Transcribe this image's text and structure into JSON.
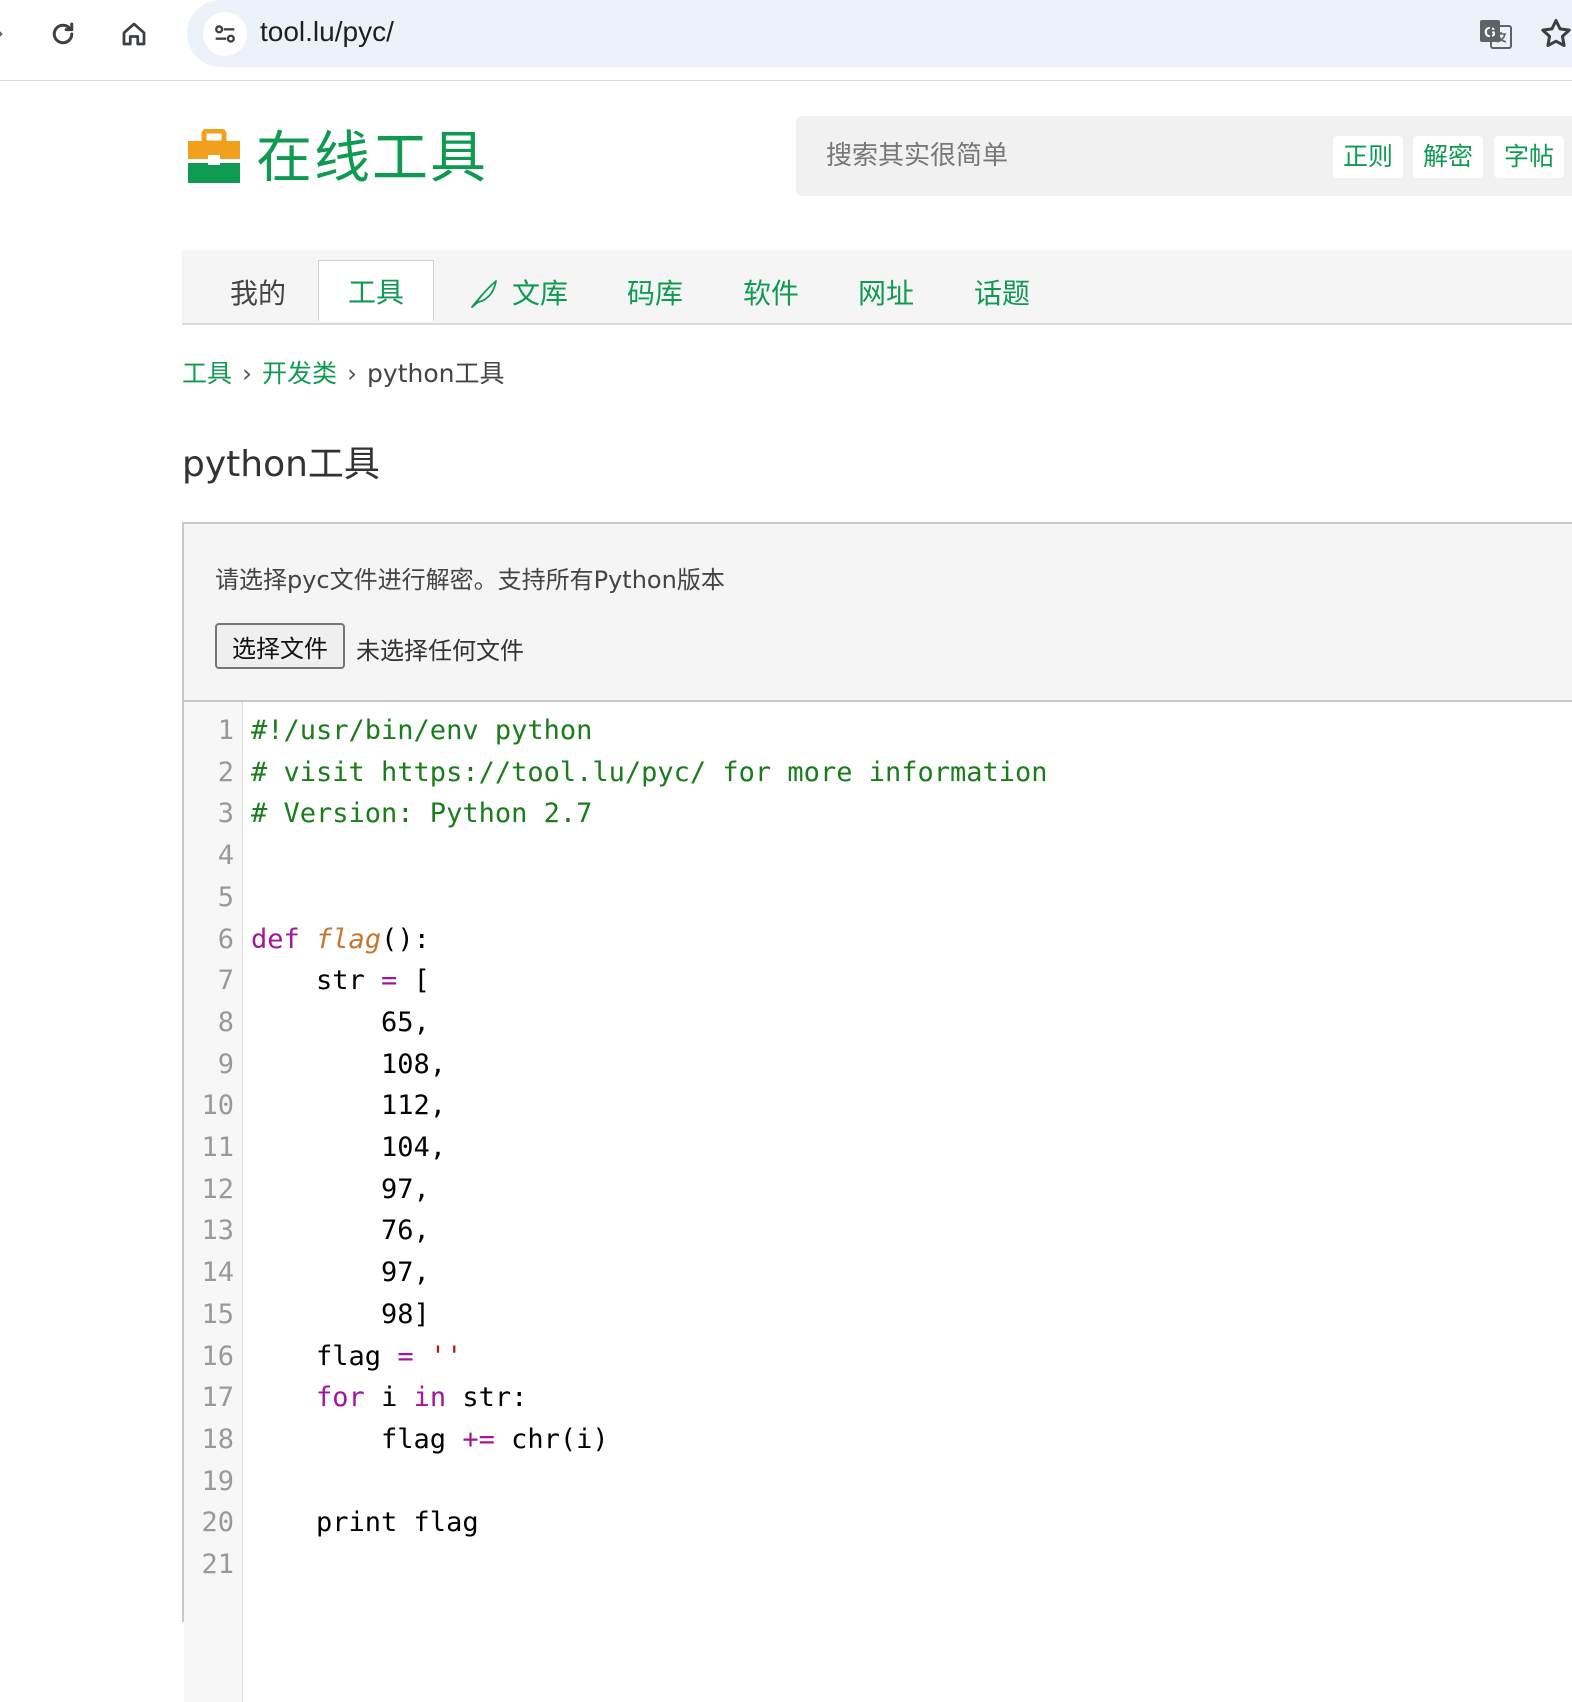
{
  "browser": {
    "url": "tool.lu/pyc/"
  },
  "header": {
    "site_title": "在线工具",
    "search_placeholder": "搜索其实很简单",
    "quick_links": [
      "正则",
      "解密",
      "字帖"
    ]
  },
  "tabs": {
    "mine": "我的",
    "tools": "工具",
    "library": "文库",
    "code": "码库",
    "software": "软件",
    "sites": "网址",
    "topics": "话题"
  },
  "breadcrumb": {
    "root": "工具",
    "category": "开发类",
    "current": "python工具"
  },
  "page": {
    "title": "python工具"
  },
  "tool": {
    "instruction": "请选择pyc文件进行解密。支持所有Python版本",
    "file_button": "选择文件",
    "file_status": "未选择任何文件"
  },
  "code": {
    "lines": [
      {
        "n": "1",
        "parts": [
          {
            "t": "#!/usr/bin/env python",
            "c": "comment"
          }
        ]
      },
      {
        "n": "2",
        "parts": [
          {
            "t": "# visit https://tool.lu/pyc/ for more information",
            "c": "comment"
          }
        ]
      },
      {
        "n": "3",
        "parts": [
          {
            "t": "# Version: Python 2.7",
            "c": "comment"
          }
        ]
      },
      {
        "n": "4",
        "parts": []
      },
      {
        "n": "5",
        "parts": []
      },
      {
        "n": "6",
        "parts": [
          {
            "t": "def",
            "c": "kw"
          },
          {
            "t": " ",
            "c": ""
          },
          {
            "t": "flag",
            "c": "fn"
          },
          {
            "t": "():",
            "c": ""
          }
        ]
      },
      {
        "n": "7",
        "parts": [
          {
            "t": "    str ",
            "c": ""
          },
          {
            "t": "=",
            "c": "op"
          },
          {
            "t": " [",
            "c": ""
          }
        ]
      },
      {
        "n": "8",
        "parts": [
          {
            "t": "        65,",
            "c": ""
          }
        ]
      },
      {
        "n": "9",
        "parts": [
          {
            "t": "        108,",
            "c": ""
          }
        ]
      },
      {
        "n": "10",
        "parts": [
          {
            "t": "        112,",
            "c": ""
          }
        ]
      },
      {
        "n": "11",
        "parts": [
          {
            "t": "        104,",
            "c": ""
          }
        ]
      },
      {
        "n": "12",
        "parts": [
          {
            "t": "        97,",
            "c": ""
          }
        ]
      },
      {
        "n": "13",
        "parts": [
          {
            "t": "        76,",
            "c": ""
          }
        ]
      },
      {
        "n": "14",
        "parts": [
          {
            "t": "        97,",
            "c": ""
          }
        ]
      },
      {
        "n": "15",
        "parts": [
          {
            "t": "        98]",
            "c": ""
          }
        ]
      },
      {
        "n": "16",
        "parts": [
          {
            "t": "    flag ",
            "c": ""
          },
          {
            "t": "=",
            "c": "op"
          },
          {
            "t": " ",
            "c": ""
          },
          {
            "t": "''",
            "c": "str"
          }
        ]
      },
      {
        "n": "17",
        "parts": [
          {
            "t": "    ",
            "c": ""
          },
          {
            "t": "for",
            "c": "kw"
          },
          {
            "t": " i ",
            "c": ""
          },
          {
            "t": "in",
            "c": "kw"
          },
          {
            "t": " str:",
            "c": ""
          }
        ]
      },
      {
        "n": "18",
        "parts": [
          {
            "t": "        flag ",
            "c": ""
          },
          {
            "t": "+=",
            "c": "op"
          },
          {
            "t": " chr(i)",
            "c": ""
          }
        ]
      },
      {
        "n": "19",
        "parts": []
      },
      {
        "n": "20",
        "parts": [
          {
            "t": "    print flag",
            "c": ""
          }
        ]
      },
      {
        "n": "21",
        "parts": []
      }
    ]
  }
}
